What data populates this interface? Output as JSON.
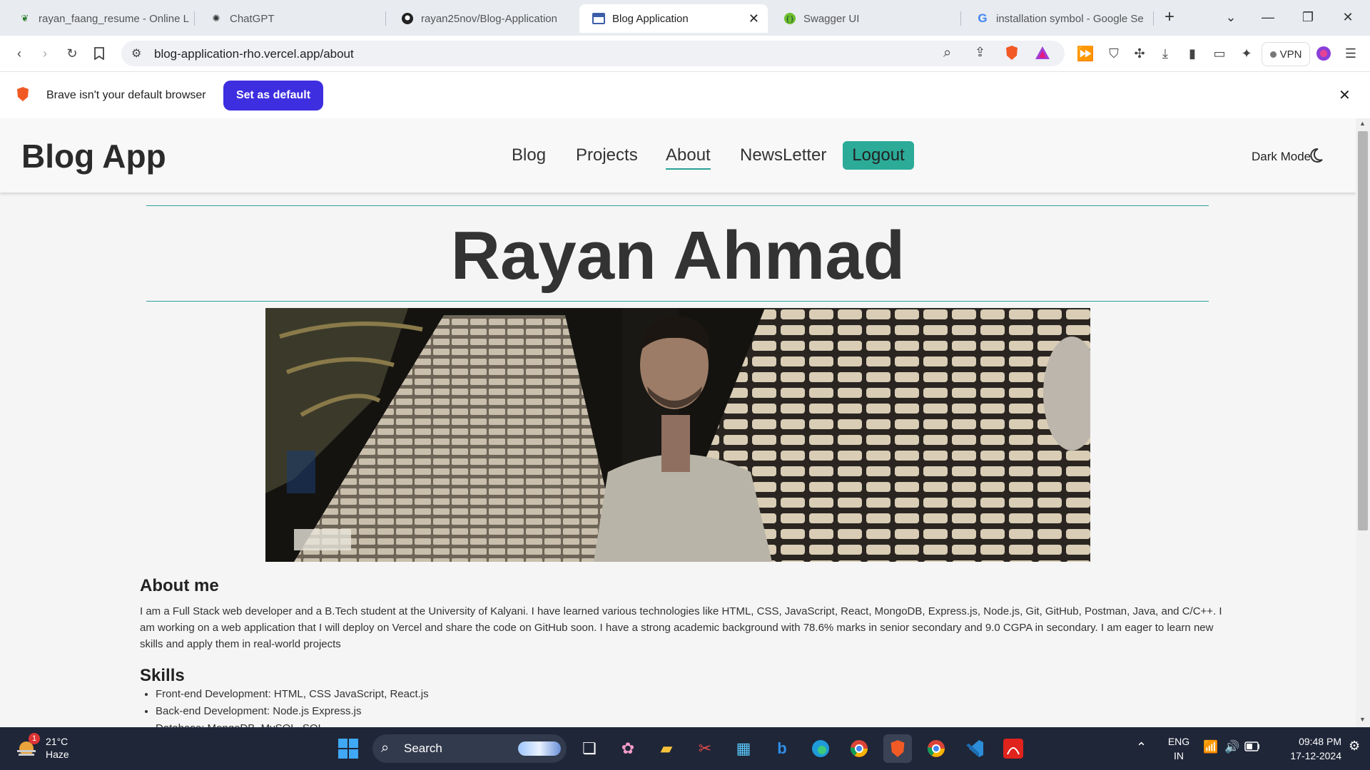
{
  "browser": {
    "tabs": [
      {
        "title": "rayan_faang_resume - Online L",
        "icon": "overleaf-icon"
      },
      {
        "title": "ChatGPT",
        "icon": "chatgpt-icon"
      },
      {
        "title": "rayan25nov/Blog-Application",
        "icon": "github-icon"
      },
      {
        "title": "Blog Application",
        "icon": "blog-icon",
        "active": true
      },
      {
        "title": "Swagger UI",
        "icon": "swagger-icon"
      },
      {
        "title": "installation symbol - Google Se",
        "icon": "google-icon"
      }
    ],
    "url": "blog-application-rho.vercel.app/about",
    "vpn_label": "VPN",
    "banner": {
      "text": "Brave isn't your default browser",
      "button": "Set as default"
    }
  },
  "site": {
    "brand": "Blog App",
    "nav": [
      "Blog",
      "Projects",
      "About",
      "NewsLetter"
    ],
    "logout": "Logout",
    "dark_mode": "Dark Mode",
    "name": "Rayan Ahmad",
    "about_heading": "About me",
    "about_text": "I am a Full Stack web developer and a B.Tech student at the University of Kalyani. I have learned various technologies like HTML, CSS, JavaScript, React, MongoDB, Express.js, Node.js, Git, GitHub, Postman, Java, and C/C++. I am working on a web application that I will deploy on Vercel and share the code on GitHub soon. I have a strong academic background with 78.6% marks in senior secondary and 9.0 CGPA in secondary. I am eager to learn new skills and apply them in real-world projects",
    "skills_heading": "Skills",
    "skills": [
      "Front-end Development: HTML, CSS JavaScript, React.js",
      "Back-end Development: Node.js Express.js",
      "Database: MongoDB, MySQL, SQL"
    ]
  },
  "taskbar": {
    "weather_temp": "21°C",
    "weather_desc": "Haze",
    "weather_badge": "1",
    "search": "Search",
    "lang_top": "ENG",
    "lang_bottom": "IN",
    "time": "09:48 PM",
    "date": "17-12-2024"
  }
}
